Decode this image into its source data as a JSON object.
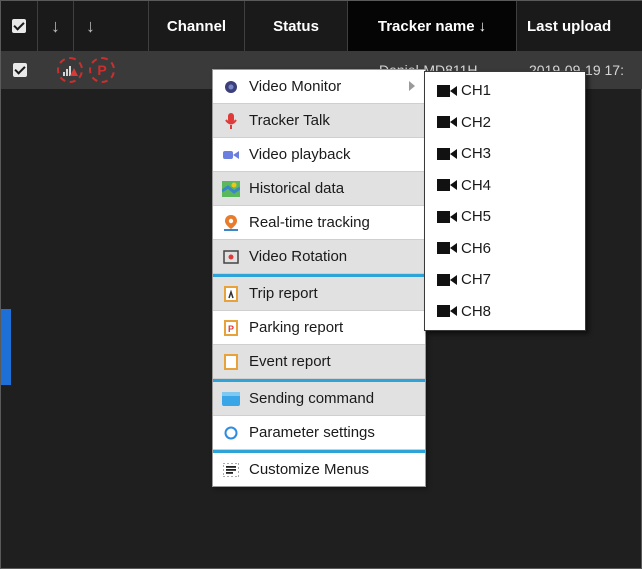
{
  "table": {
    "headers": {
      "channel": "Channel",
      "status": "Status",
      "tracker_name": "Tracker name",
      "last_upload": "Last upload"
    },
    "sort_arrow": "↓",
    "row": {
      "tracker_name": "Daniel-MD811H_...",
      "last_upload": "2019-09-19 17:",
      "status_icons": [
        "signal-warning-icon",
        "parking-icon"
      ]
    }
  },
  "context_menu": {
    "items": [
      {
        "label": "Video Monitor",
        "icon": "video-monitor-icon",
        "shaded": false,
        "submenu": true
      },
      {
        "label": "Tracker Talk",
        "icon": "microphone-icon",
        "shaded": true
      },
      {
        "label": "Video playback",
        "icon": "video-camera-icon",
        "shaded": false
      },
      {
        "label": "Historical data",
        "icon": "map-icon",
        "shaded": true
      },
      {
        "label": "Real-time tracking",
        "icon": "location-pin-icon",
        "shaded": false
      },
      {
        "label": "Video Rotation",
        "icon": "rotation-icon",
        "shaded": true
      },
      {
        "label": "Trip report",
        "icon": "trip-report-icon",
        "shaded": true
      },
      {
        "label": "Parking report",
        "icon": "parking-report-icon",
        "shaded": false
      },
      {
        "label": "Event report",
        "icon": "event-report-icon",
        "shaded": true
      },
      {
        "label": "Sending command",
        "icon": "command-icon",
        "shaded": true
      },
      {
        "label": "Parameter settings",
        "icon": "settings-circle-icon",
        "shaded": false
      },
      {
        "label": "Customize Menus",
        "icon": "list-menu-icon",
        "shaded": false
      }
    ]
  },
  "submenu": {
    "channels": [
      "CH1",
      "CH2",
      "CH3",
      "CH4",
      "CH5",
      "CH6",
      "CH7",
      "CH8"
    ]
  },
  "colors": {
    "header_bg": "#1a1a1a",
    "row_bg": "#3a3a3a",
    "accent": "#2da3d8",
    "left_tab": "#1e6fd6"
  }
}
